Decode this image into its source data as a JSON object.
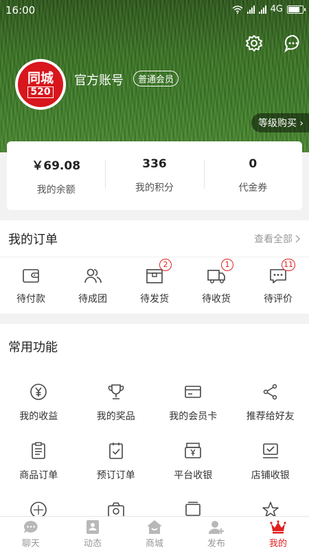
{
  "status_bar": {
    "time": "16:00",
    "network": "4G"
  },
  "profile": {
    "avatar_text_top": "同城",
    "avatar_text_bottom": "520",
    "name": "官方账号",
    "member_level": "普通会员",
    "level_buy": "等级购买"
  },
  "stats": [
    {
      "value": "￥69.08",
      "label": "我的余额"
    },
    {
      "value": "336",
      "label": "我的积分"
    },
    {
      "value": "0",
      "label": "代金券"
    }
  ],
  "orders": {
    "title": "我的订单",
    "view_all": "查看全部",
    "items": [
      {
        "label": "待付款",
        "icon": "wallet-icon",
        "badge": ""
      },
      {
        "label": "待成团",
        "icon": "group-icon",
        "badge": ""
      },
      {
        "label": "待发货",
        "icon": "box-icon",
        "badge": "2"
      },
      {
        "label": "待收货",
        "icon": "truck-icon",
        "badge": "1"
      },
      {
        "label": "待评价",
        "icon": "comment-icon",
        "badge": "11"
      }
    ]
  },
  "common": {
    "title": "常用功能",
    "items": [
      {
        "label": "我的收益",
        "icon": "yen-coin-icon"
      },
      {
        "label": "我的奖品",
        "icon": "trophy-icon"
      },
      {
        "label": "我的会员卡",
        "icon": "card-icon"
      },
      {
        "label": "推荐给好友",
        "icon": "share-icon"
      },
      {
        "label": "商品订单",
        "icon": "clipboard-icon"
      },
      {
        "label": "预订订单",
        "icon": "checklist-icon"
      },
      {
        "label": "平台收银",
        "icon": "cashier-icon"
      },
      {
        "label": "店铺收银",
        "icon": "store-cashier-icon"
      }
    ]
  },
  "tabs": [
    {
      "label": "聊天",
      "icon": "chat-icon"
    },
    {
      "label": "动态",
      "icon": "contacts-icon"
    },
    {
      "label": "商城",
      "icon": "shop-icon"
    },
    {
      "label": "发布",
      "icon": "publish-icon"
    },
    {
      "label": "我的",
      "icon": "crown-icon",
      "active": true
    }
  ],
  "colors": {
    "accent": "#e02020",
    "grass": "#3e7c28"
  }
}
